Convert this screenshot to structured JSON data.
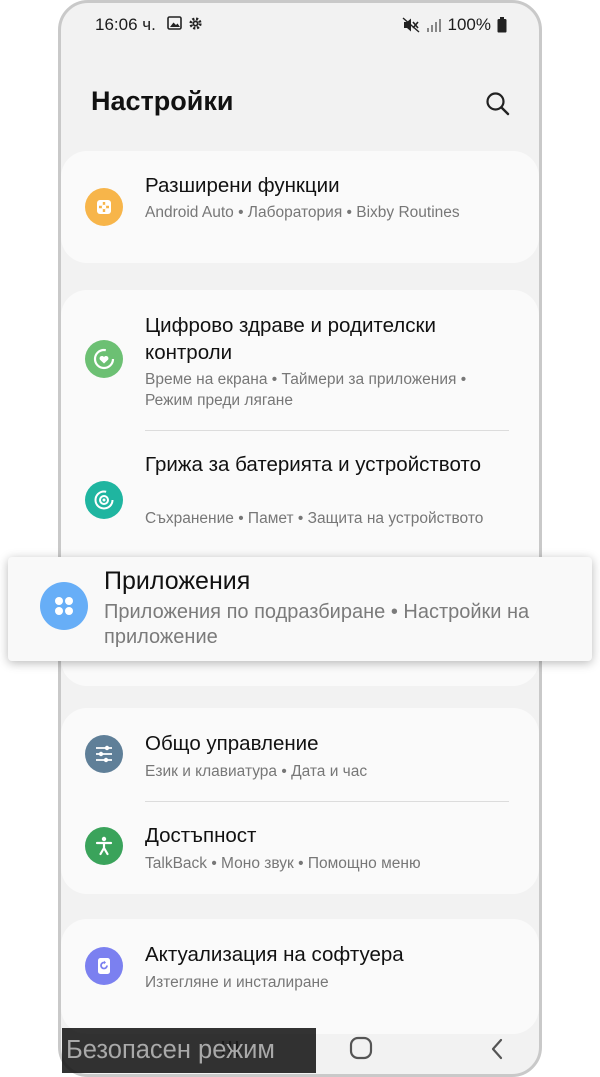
{
  "status_bar": {
    "time": "16:06 ч.",
    "battery": "100%"
  },
  "header": {
    "title": "Настройки"
  },
  "items": [
    {
      "title": "Разширени функции",
      "subtitle": "Android Auto • Лаборатория • Bixby Routines",
      "icon": "advanced-features-icon",
      "color": "#f7b54a"
    },
    {
      "title": "Цифрово здраве и родителски контроли",
      "subtitle": "Време на екрана • Таймери за приложения • Режим преди лягане",
      "icon": "digital-wellbeing-icon",
      "color": "#6cc073"
    },
    {
      "title": "Грижа за батерията и устройството",
      "subtitle": "Съхранение • Памет • Защита на устройството",
      "icon": "device-care-icon",
      "color": "#1fb5a0"
    },
    {
      "title": "Общо управление",
      "subtitle": "Език и клавиатура • Дата и час",
      "icon": "general-management-icon",
      "color": "#5f7f98"
    },
    {
      "title": "Достъпност",
      "subtitle": "TalkBack • Моно звук • Помощно меню",
      "icon": "accessibility-icon",
      "color": "#3aa35b"
    },
    {
      "title": "Актуализация на софтуера",
      "subtitle": "Изтегляне и инсталиране",
      "icon": "software-update-icon",
      "color": "#7b80f0"
    }
  ],
  "highlight": {
    "title": "Приложения",
    "subtitle": "Приложения по подразбиране • Настройки на приложение",
    "icon": "apps-icon",
    "color": "#67aef7"
  },
  "safe_mode": {
    "label": "Безопасен режим"
  }
}
